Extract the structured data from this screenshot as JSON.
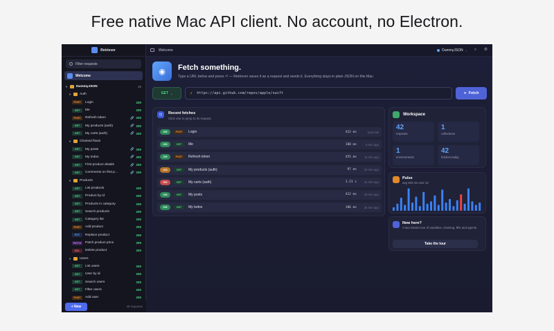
{
  "headline": "Free native Mac API client. No account, no Electron.",
  "app": {
    "name": "Retriever"
  },
  "sidebar": {
    "filter_placeholder": "Filter requests",
    "welcome": "Welcome",
    "collection": {
      "name": "DummyJSON",
      "count": "48"
    },
    "new_label": "+ New",
    "request_count": "48 requests",
    "rows": [
      {
        "type": "folder",
        "label": "Auth"
      },
      {
        "type": "req",
        "method": "POST",
        "label": "Login",
        "status": "200"
      },
      {
        "type": "req",
        "method": "GET",
        "label": "Me",
        "status": "200"
      },
      {
        "type": "req",
        "method": "POST",
        "label": "Refresh token",
        "status": "200",
        "chain": true
      },
      {
        "type": "req",
        "method": "GET",
        "label": "My products (auth)",
        "status": "200",
        "chain": true
      },
      {
        "type": "req",
        "method": "GET",
        "label": "My carts (auth)",
        "status": "200",
        "chain": true
      },
      {
        "type": "folder",
        "label": "Chained flows"
      },
      {
        "type": "req",
        "method": "GET",
        "label": "My posts",
        "status": "200",
        "chain": true
      },
      {
        "type": "req",
        "method": "GET",
        "label": "My todos",
        "status": "200",
        "chain": true
      },
      {
        "type": "req",
        "method": "GET",
        "label": "First product details",
        "status": "200",
        "chain": true
      },
      {
        "type": "req",
        "method": "GET",
        "label": "Comments on first p…",
        "status": "200",
        "chain": true
      },
      {
        "type": "folder",
        "label": "Products"
      },
      {
        "type": "req",
        "method": "GET",
        "label": "List products",
        "status": "200"
      },
      {
        "type": "req",
        "method": "GET",
        "label": "Product by id",
        "status": "200"
      },
      {
        "type": "req",
        "method": "GET",
        "label": "Products in category",
        "status": "200"
      },
      {
        "type": "req",
        "method": "GET",
        "label": "Search products",
        "status": "200"
      },
      {
        "type": "req",
        "method": "GET",
        "label": "Category list",
        "status": "200"
      },
      {
        "type": "req",
        "method": "POST",
        "label": "Add product",
        "status": "200"
      },
      {
        "type": "req",
        "method": "PUT",
        "label": "Replace product",
        "status": "200"
      },
      {
        "type": "req",
        "method": "PATCH",
        "label": "Patch product price",
        "status": "200"
      },
      {
        "type": "req",
        "method": "DEL",
        "label": "Delete product",
        "status": "200"
      },
      {
        "type": "folder",
        "label": "Users"
      },
      {
        "type": "req",
        "method": "GET",
        "label": "List users",
        "status": "200"
      },
      {
        "type": "req",
        "method": "GET",
        "label": "User by id",
        "status": "200"
      },
      {
        "type": "req",
        "method": "GET",
        "label": "Search users",
        "status": "200"
      },
      {
        "type": "req",
        "method": "GET",
        "label": "Filter users",
        "status": "200"
      },
      {
        "type": "req",
        "method": "POST",
        "label": "Add user",
        "status": "200"
      }
    ]
  },
  "topbar": {
    "title": "Welcome",
    "environment": "DummyJSON"
  },
  "hero": {
    "title": "Fetch something.",
    "subtitle": "Type a URL below and press ⏎ — Retriever saves it as a request and sends it. Everything stays in plain JSON on this Mac."
  },
  "request_bar": {
    "method": "GET",
    "url": "https://api.github.com/repos/apple/swift",
    "fetch_label": "Fetch"
  },
  "recent": {
    "title": "Recent fetches",
    "subtitle": "Click one to jump to its request.",
    "items": [
      {
        "status": "200",
        "method": "POST",
        "name": "Login",
        "ms": "412 ms",
        "ago": "just now"
      },
      {
        "status": "200",
        "method": "GET",
        "name": "Me",
        "ms": "188 ms",
        "ago": "5 min ago"
      },
      {
        "status": "200",
        "method": "POST",
        "name": "Refresh token",
        "ms": "455 ms",
        "ago": "11 min ago"
      },
      {
        "status": "404",
        "method": "GET",
        "name": "My products (auth)",
        "ms": "97 ms",
        "ago": "15 min ago"
      },
      {
        "status": "500",
        "method": "GET",
        "name": "My carts (auth)",
        "ms": "1.21 s",
        "ago": "21 min ago"
      },
      {
        "status": "200",
        "method": "GET",
        "name": "My posts",
        "ms": "412 ms",
        "ago": "28 min ago"
      },
      {
        "status": "200",
        "method": "GET",
        "name": "My todos",
        "ms": "186 ms",
        "ago": "34 min ago"
      }
    ]
  },
  "workspace": {
    "title": "Workspace",
    "stats": [
      {
        "value": "42",
        "label": "requests"
      },
      {
        "value": "1",
        "label": "collections"
      },
      {
        "value": "1",
        "label": "environments"
      },
      {
        "value": "42",
        "label": "fetches today"
      }
    ]
  },
  "pulse": {
    "title": "Pulse",
    "subtitle": "avg 463 ms over 24",
    "bars": [
      0.15,
      0.3,
      0.55,
      0.25,
      0.95,
      0.35,
      0.6,
      0.2,
      0.8,
      0.3,
      0.4,
      0.65,
      0.25,
      0.9,
      0.35,
      0.5,
      0.2,
      0.45,
      0.7,
      0.3,
      0.95,
      0.4,
      0.25,
      0.35
    ],
    "error_index": 18,
    "colors": {
      "normal": "#3b82f6",
      "error": "#ef4444"
    }
  },
  "new_here": {
    "title": "New here?",
    "subtitle": "A two-minute tour of variables, chaining, ⌘K and agents.",
    "button": "Take the tour"
  }
}
